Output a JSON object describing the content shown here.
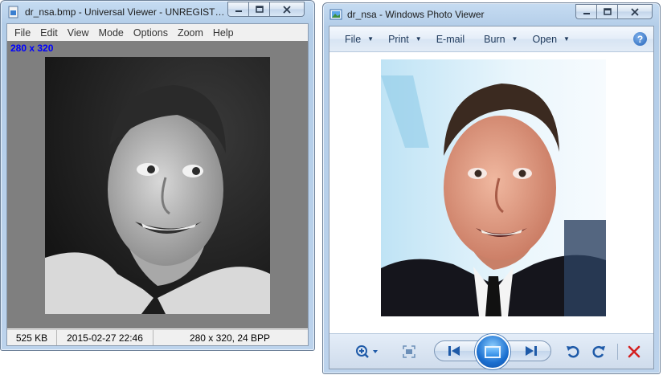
{
  "universal_viewer": {
    "title": "dr_nsa.bmp - Universal Viewer - UNREGISTER...",
    "menu": [
      "File",
      "Edit",
      "View",
      "Mode",
      "Options",
      "Zoom",
      "Help"
    ],
    "dims_overlay": "280 x 320",
    "status": {
      "size": "525 KB",
      "date": "2015-02-27 22:46",
      "info": "280 x 320, 24 BPP"
    }
  },
  "photo_viewer": {
    "title": "dr_nsa - Windows Photo Viewer",
    "commands": [
      {
        "label": "File",
        "dropdown": true
      },
      {
        "label": "Print",
        "dropdown": true
      },
      {
        "label": "E-mail",
        "dropdown": false
      },
      {
        "label": "Burn",
        "dropdown": true
      },
      {
        "label": "Open",
        "dropdown": true
      }
    ],
    "help": "?"
  },
  "icons": {
    "uv_app": "universal-viewer-icon",
    "wpv_app": "photo-viewer-icon",
    "zoom": "zoom-icon",
    "fit": "actual-size-icon",
    "prev": "previous-icon",
    "slideshow": "slideshow-icon",
    "next": "next-icon",
    "rotate_ccw": "rotate-counterclockwise-icon",
    "rotate_cw": "rotate-clockwise-icon",
    "delete": "delete-icon"
  },
  "colors": {
    "dims_overlay": "#0000ff",
    "delete": "#d42020",
    "nav_blue": "#1e5aa8"
  }
}
